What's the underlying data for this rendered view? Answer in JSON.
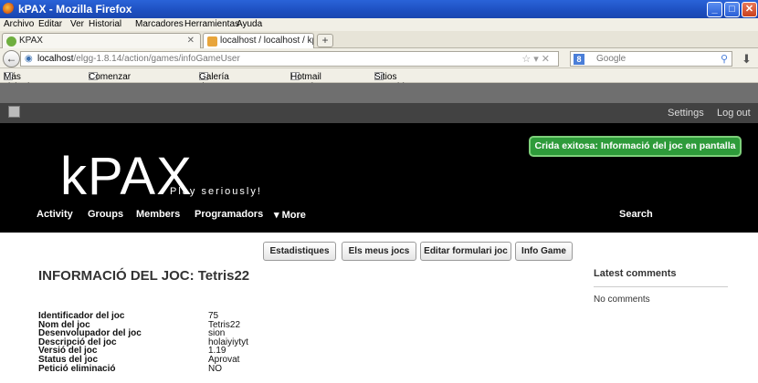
{
  "window": {
    "title": "kPAX - Mozilla Firefox"
  },
  "menu": [
    "Archivo",
    "Editar",
    "Ver",
    "Historial",
    "Marcadores",
    "Herramientas",
    "Ayuda"
  ],
  "tabs": [
    {
      "label": "KPAX"
    },
    {
      "label": "localhost / localhost / kpax / game | php..."
    }
  ],
  "address": {
    "host": "localhost",
    "path": "/elgg-1.8.14/action/games/infoGameUser"
  },
  "search": {
    "placeholder": "Google"
  },
  "bookmarks": [
    "Más visitados",
    "Comenzar a usar Firef...",
    "Galería de Web Slice",
    "Hotmail gratuito",
    "Sitios sugeridos"
  ],
  "topbar": {
    "settings": "Settings",
    "logout": "Log out"
  },
  "site": {
    "logo": "kPAX",
    "tagline": "Play seriously!"
  },
  "message": "Crida exitosa: Informació del joc en pantalla",
  "nav": [
    "Activity",
    "Groups",
    "Members",
    "Programadors",
    "▾ More"
  ],
  "nav_search": "Search",
  "actions": [
    "Estadistiques",
    "Els meus jocs",
    "Editar formulari joc",
    "Info Game"
  ],
  "page_title": "INFORMACIÓ DEL JOC: Tetris22",
  "sidebar": {
    "title": "Latest comments",
    "empty": "No comments"
  },
  "info": [
    {
      "label": "Identificador del joc",
      "value": "75"
    },
    {
      "label": "Nom del joc",
      "value": "Tetris22"
    },
    {
      "label": "Desenvolupador del joc",
      "value": "sion"
    },
    {
      "label": "Descripció del joc",
      "value": "holaiyiytyt"
    },
    {
      "label": "Versió del joc",
      "value": "1.19"
    },
    {
      "label": "Status del joc",
      "value": "Aprovat"
    },
    {
      "label": "Petició eliminació",
      "value": "NO"
    }
  ],
  "colors": {
    "success": "#2e9b3a",
    "header": "#000000",
    "titlebar": "#2a63d8"
  }
}
